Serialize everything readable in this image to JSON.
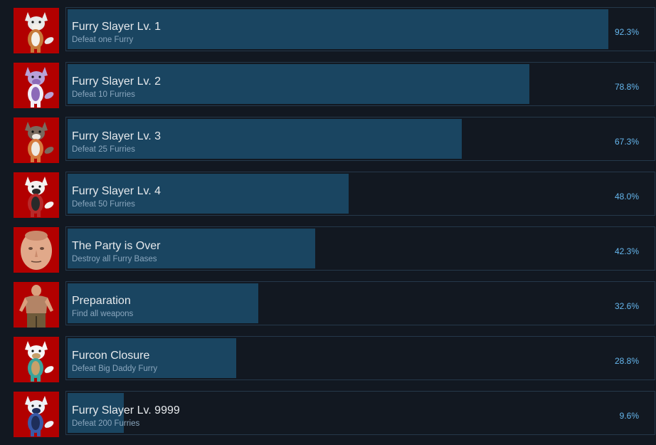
{
  "achievements": [
    {
      "title": "Furry Slayer Lv. 1",
      "description": "Defeat one Furry",
      "percent": "92.3%",
      "value": 92.3,
      "icon": "fox-furry-icon",
      "kind": "furry",
      "colors": [
        "#e8e8e8",
        "#c77a3a",
        "#f4efe9"
      ]
    },
    {
      "title": "Furry Slayer Lv. 2",
      "description": "Defeat 10 Furries",
      "percent": "78.8%",
      "value": 78.8,
      "icon": "purple-furry-icon",
      "kind": "furry",
      "colors": [
        "#b8a2d8",
        "#f2eef8",
        "#8c6ab8"
      ]
    },
    {
      "title": "Furry Slayer Lv. 3",
      "description": "Defeat 25 Furries",
      "percent": "67.3%",
      "value": 67.3,
      "icon": "raccoon-furry-icon",
      "kind": "furry",
      "colors": [
        "#7a6a5e",
        "#d67a3e",
        "#efe9e3"
      ]
    },
    {
      "title": "Furry Slayer Lv. 4",
      "description": "Defeat 50 Furries",
      "percent": "48.0%",
      "value": 48.0,
      "icon": "red-fox-furry-icon",
      "kind": "furry",
      "colors": [
        "#f4f1ef",
        "#b82a2a",
        "#2a2a2a"
      ]
    },
    {
      "title": "The Party is Over",
      "description": "Destroy all Furry Bases",
      "percent": "42.3%",
      "value": 42.3,
      "icon": "face-portrait-icon",
      "kind": "face",
      "colors": [
        "#e1a98a",
        "#c98a6c",
        "#6b4a3a"
      ]
    },
    {
      "title": "Preparation",
      "description": "Find all weapons",
      "percent": "32.6%",
      "value": 32.6,
      "icon": "shirtless-man-icon",
      "kind": "man",
      "colors": [
        "#d9a07e",
        "#6e5a3a",
        "#b38466"
      ]
    },
    {
      "title": "Furcon Closure",
      "description": "Defeat Big Daddy Furry",
      "percent": "28.8%",
      "value": 28.8,
      "icon": "white-bunny-furry-icon",
      "kind": "furry",
      "colors": [
        "#f6f6f6",
        "#3aa39a",
        "#c7a06a"
      ]
    },
    {
      "title": "Furry Slayer Lv. 9999",
      "description": "Defeat 200 Furries",
      "percent": "9.6%",
      "value": 9.6,
      "icon": "blue-wolf-furry-icon",
      "kind": "furry",
      "colors": [
        "#eef1f6",
        "#3a5aa8",
        "#1e2e5a"
      ]
    }
  ],
  "colors": {
    "background": "#121821",
    "bar_fill": "#1a4561",
    "bar_border": "#25384a",
    "icon_background": "#b20000",
    "title_text": "#e6e9ec",
    "description_text": "#8aa6bd",
    "percent_text": "#66b7ee"
  }
}
